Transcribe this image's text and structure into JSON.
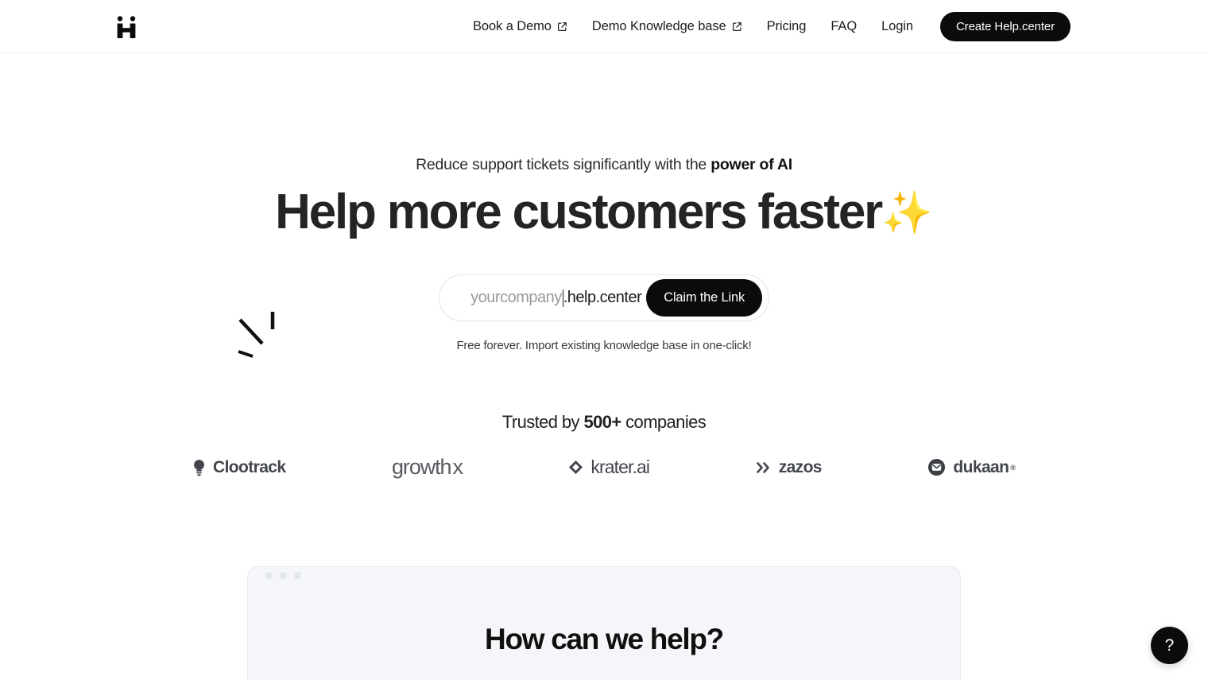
{
  "header": {
    "logo_alt": "Help.center logo",
    "nav": [
      {
        "label": "Book a Demo",
        "external": true
      },
      {
        "label": "Demo Knowledge base",
        "external": true
      },
      {
        "label": "Pricing",
        "external": false
      },
      {
        "label": "FAQ",
        "external": false
      },
      {
        "label": "Login",
        "external": false
      }
    ],
    "cta_label": "Create Help.center"
  },
  "hero": {
    "eyebrow_prefix": "Reduce support tickets significantly with the ",
    "eyebrow_strong": "power of AI",
    "headline": "Help more customers faster",
    "headline_emoji": "✨",
    "claim": {
      "input_placeholder": "yourcompany",
      "input_value": "",
      "suffix": ".help.center",
      "button_label": "Claim the Link"
    },
    "subnote": "Free forever. Import existing knowledge base in one-click!"
  },
  "trusted": {
    "prefix": "Trusted by ",
    "count": "500+",
    "suffix": " companies",
    "logos": [
      {
        "name": "Clootrack",
        "icon": "lightbulb-icon"
      },
      {
        "name": "growth",
        "superscript": "x",
        "icon": "none"
      },
      {
        "name": "krater.ai",
        "icon": "diamond-icon"
      },
      {
        "name": "zazos",
        "icon": "double-chevron-icon"
      },
      {
        "name": "dukaan",
        "registered": "®",
        "icon": "dukaan-badge-icon"
      }
    ]
  },
  "preview": {
    "title": "How can we help?"
  },
  "help_fab": {
    "label": "?"
  },
  "colors": {
    "accent_dark": "#0b0b0b",
    "text": "#232323",
    "muted": "#9a9a9a",
    "panel_bg": "#f4f6f9",
    "border": "#ececec"
  }
}
